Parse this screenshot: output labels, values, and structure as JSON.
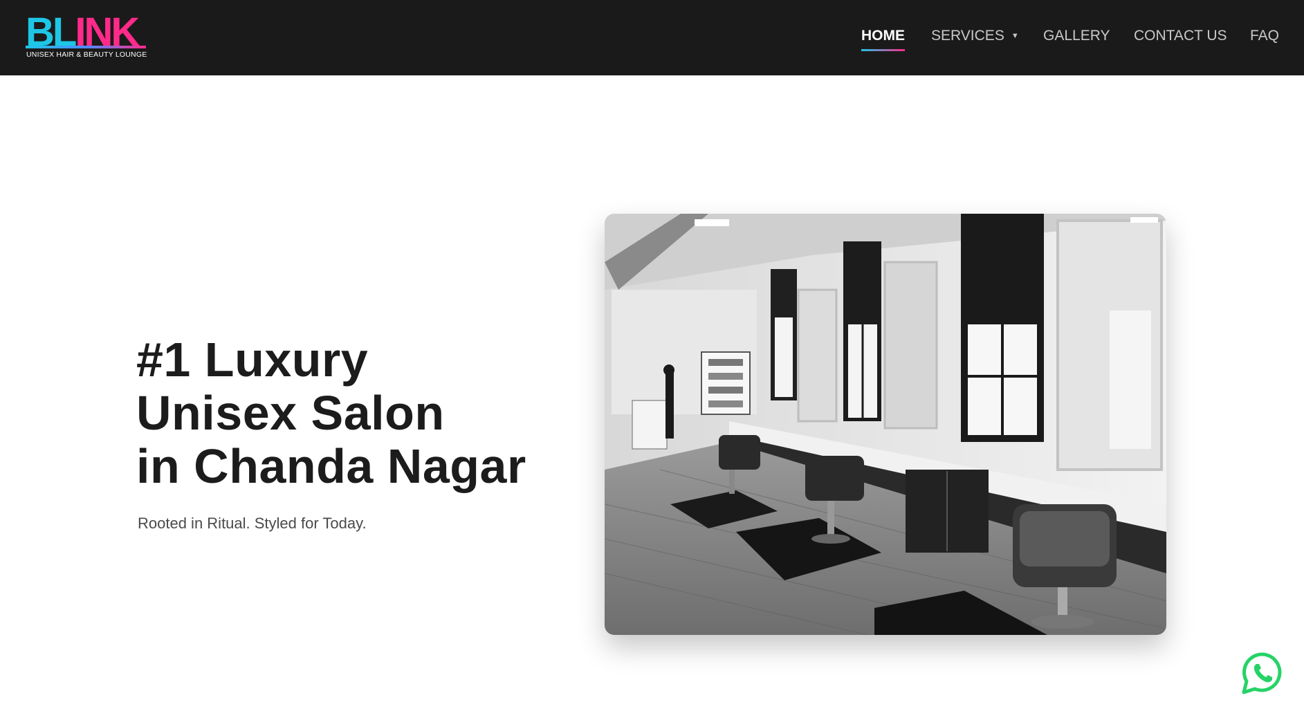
{
  "brand": {
    "logo_text_b": "BL",
    "logo_text_rest": "INK",
    "tagline": "UNISEX HAIR & BEAUTY LOUNGE",
    "colors": {
      "cyan": "#1ec6e6",
      "pink": "#ff2a8a",
      "header_bg": "#1b1a1b"
    }
  },
  "nav": {
    "items": [
      {
        "label": "HOME",
        "active": true
      },
      {
        "label": "SERVICES",
        "has_dropdown": true
      },
      {
        "label": "GALLERY"
      },
      {
        "label": "CONTACT US"
      },
      {
        "label": "FAQ"
      }
    ]
  },
  "hero": {
    "title_line1": "#1 Luxury",
    "title_line2": "Unisex Salon",
    "title_line3": "in Chanda Nagar",
    "subtitle": "Rooted in Ritual. Styled for Today.",
    "image_icon": "salon-interior-photo"
  },
  "floating": {
    "whatsapp_icon": "whatsapp-icon",
    "whatsapp_color": "#25d366"
  }
}
